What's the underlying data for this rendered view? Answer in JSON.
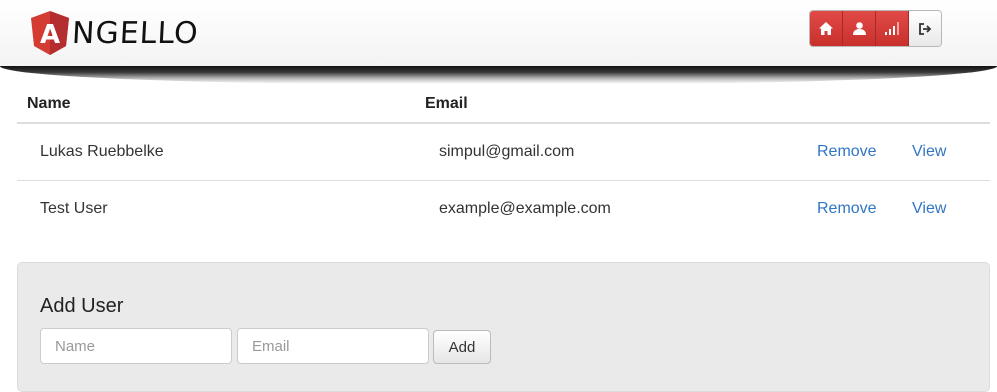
{
  "header": {
    "logo_text": "NGELLO",
    "logo_letter": "A",
    "nav": [
      {
        "icon": "home-icon"
      },
      {
        "icon": "user-icon"
      },
      {
        "icon": "signal-icon"
      },
      {
        "icon": "sign-out-icon"
      }
    ]
  },
  "table": {
    "headers": {
      "name": "Name",
      "email": "Email"
    },
    "rows": [
      {
        "name": "Lukas Ruebbelke",
        "email": "simpul@gmail.com",
        "remove": "Remove",
        "view": "View"
      },
      {
        "name": "Test User",
        "email": "example@example.com",
        "remove": "Remove",
        "view": "View"
      }
    ]
  },
  "add_user": {
    "title": "Add User",
    "name_placeholder": "Name",
    "email_placeholder": "Email",
    "button": "Add"
  },
  "colors": {
    "accent": "#c9302c",
    "link": "#3176c4",
    "panel": "#eaeaea"
  }
}
